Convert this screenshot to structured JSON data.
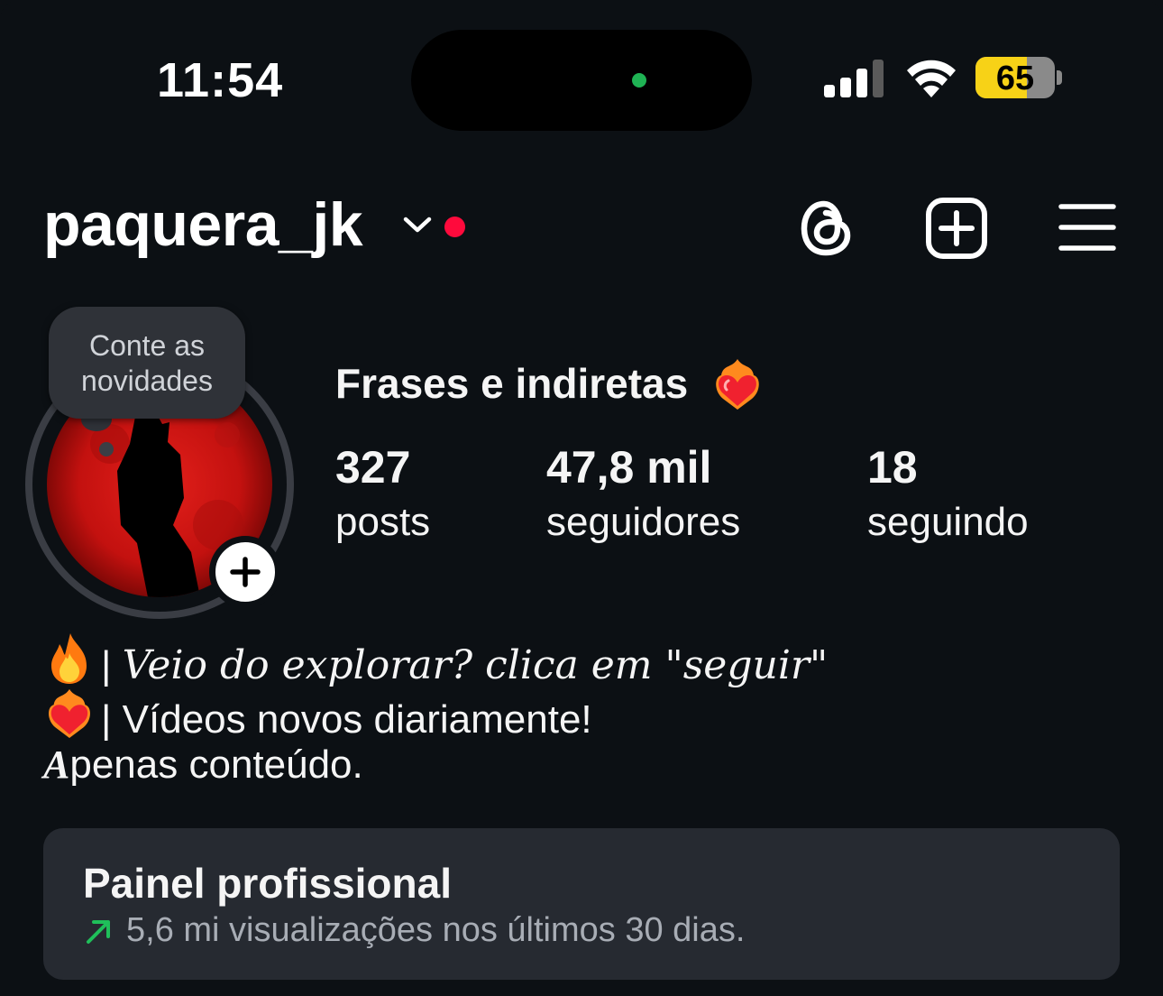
{
  "status_bar": {
    "time": "11:54",
    "battery_percent": 65,
    "battery_label": "65"
  },
  "header": {
    "username": "paquera_jk",
    "icons": [
      "chevron-down-icon",
      "notification-dot",
      "threads-icon",
      "create-post-icon",
      "menu-icon"
    ]
  },
  "profile": {
    "note_bubble": "Conte as novidades",
    "note_line1": "Conte as",
    "note_line2": "novidades",
    "display_name": "Frases e indiretas",
    "stats": {
      "posts": {
        "value": "327",
        "label": "posts"
      },
      "followers": {
        "value": "47,8 mil",
        "label": "seguidores"
      },
      "following": {
        "value": "18",
        "label": "seguindo"
      }
    }
  },
  "bio": {
    "line1_sep": "|",
    "line1_text": "Veio do explorar? clica em \"seguir\"",
    "line2_sep": "|",
    "line2_text": "Vídeos novos diariamente!",
    "line3_first": "A",
    "line3_rest": "penas conteúdo."
  },
  "dashboard": {
    "title": "Painel profissional",
    "subtitle": "5,6 mi visualizações nos últimos 30 dias."
  },
  "colors": {
    "background": "#0c1014",
    "panel": "#262a31",
    "accent_red": "#ff0a3c",
    "trend_green": "#1fbf5a",
    "battery_yellow": "#f7d217"
  }
}
